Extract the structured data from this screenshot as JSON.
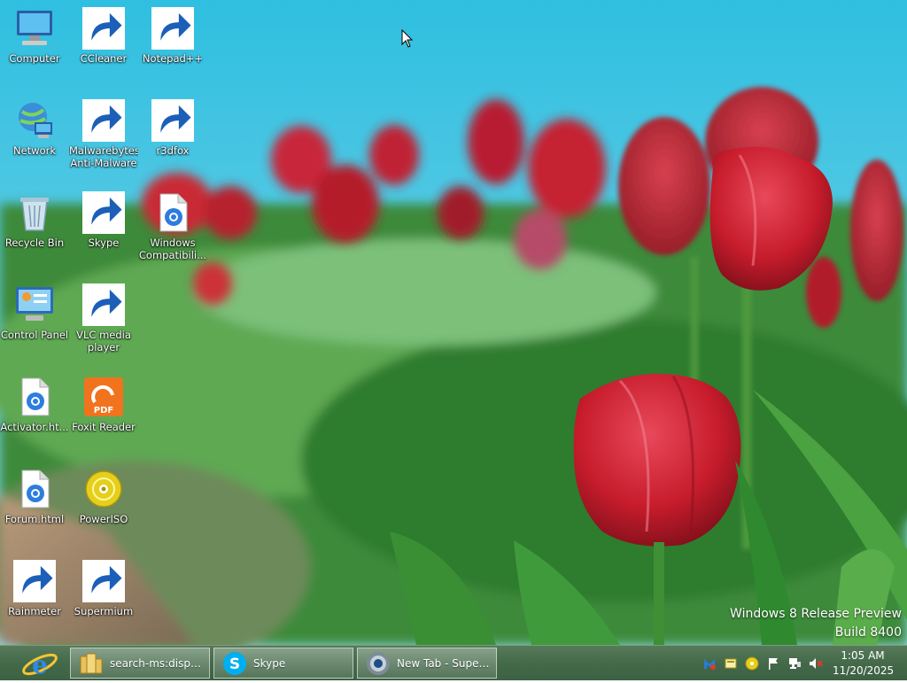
{
  "desktop": {
    "icons": [
      {
        "label": "Computer",
        "icon": "computer-icon"
      },
      {
        "label": "CCleaner",
        "icon": "ccleaner-icon"
      },
      {
        "label": "Notepad++",
        "icon": "notepad-plus-plus-icon"
      },
      {
        "label": "Network",
        "icon": "network-icon"
      },
      {
        "label": "Malwarebytes Anti-Malware",
        "icon": "malwarebytes-icon"
      },
      {
        "label": "r3dfox",
        "icon": "r3dfox-icon"
      },
      {
        "label": "Recycle Bin",
        "icon": "recycle-bin-icon"
      },
      {
        "label": "Skype",
        "icon": "skype-icon"
      },
      {
        "label": "Windows Compatibili...",
        "icon": "html-file-icon"
      },
      {
        "label": "Control Panel",
        "icon": "control-panel-icon"
      },
      {
        "label": "VLC media player",
        "icon": "vlc-icon"
      },
      {
        "label": "Activator.ht...",
        "icon": "html-file-icon"
      },
      {
        "label": "Foxit Reader",
        "icon": "foxit-reader-icon"
      },
      {
        "label": "Forum.html",
        "icon": "html-file-icon"
      },
      {
        "label": "PowerISO",
        "icon": "poweriso-icon"
      },
      {
        "label": "Rainmeter",
        "icon": "rainmeter-icon"
      },
      {
        "label": "Supermium",
        "icon": "supermium-icon"
      }
    ]
  },
  "watermark": {
    "line1": "Windows 8 Release Preview",
    "line2": "Build 8400"
  },
  "taskbar": {
    "pinned_icon": "internet-explorer-icon",
    "tasks": [
      {
        "label": "search-ms:display...",
        "icon": "folder-icon"
      },
      {
        "label": "Skype",
        "icon": "skype-icon"
      },
      {
        "label": "New Tab - Super...",
        "icon": "supermium-icon"
      }
    ],
    "tray_icons": [
      "malwarebytes-tray-icon",
      "notification-tray-icon",
      "poweriso-tray-icon",
      "action-center-flag-icon",
      "network-tray-icon",
      "volume-muted-icon"
    ],
    "clock": {
      "time": "1:05 AM",
      "date": "11/20/2025"
    }
  },
  "colors": {
    "sky": "#3fc3df",
    "tulip_red": "#c8202f",
    "leaf_green": "#3a8a36",
    "taskbar": "#4a6e50"
  }
}
